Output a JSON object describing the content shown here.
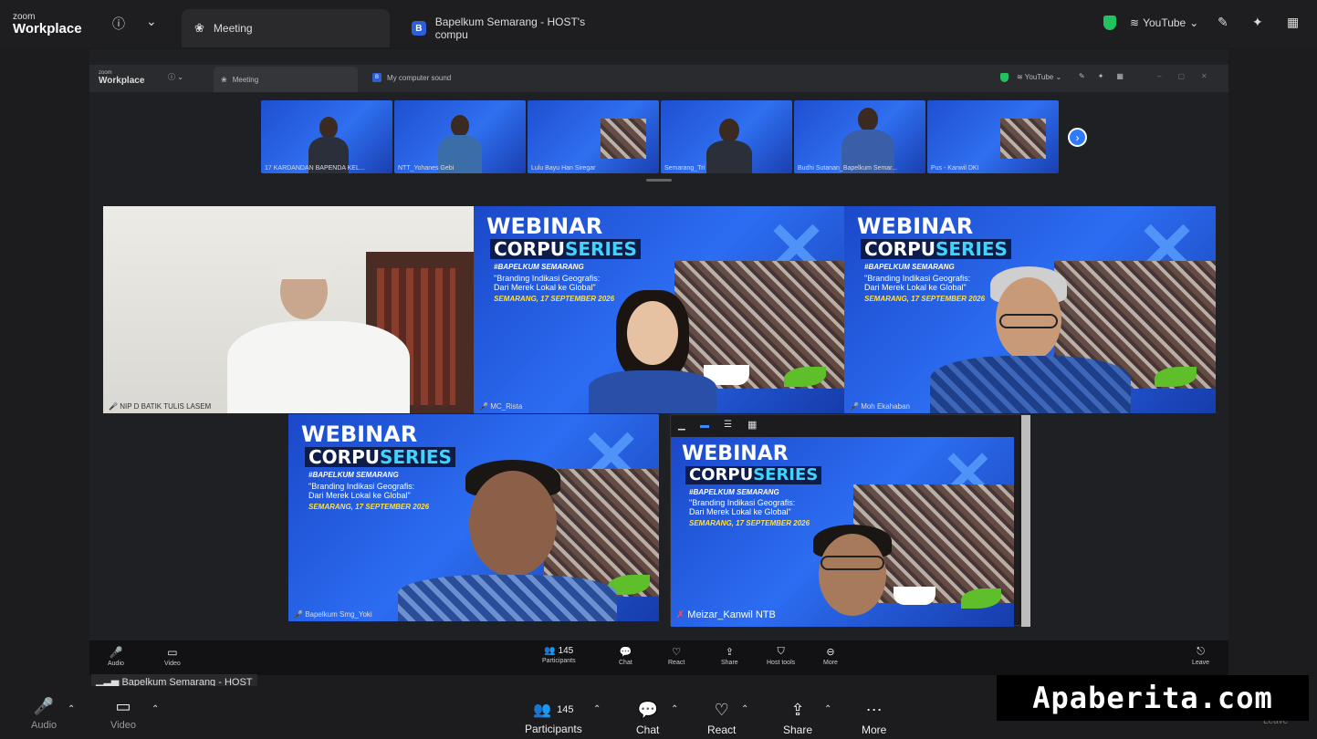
{
  "app": {
    "logo_small": "zoom",
    "logo_big": "Workplace"
  },
  "tabs": [
    {
      "label": "Meeting",
      "active": true
    },
    {
      "label": "Bapelkum Semarang - HOST's compu",
      "badge": "B",
      "active": false
    }
  ],
  "top_right": {
    "youtube_label": "YouTube"
  },
  "inner": {
    "logo_small": "zoom",
    "logo_big": "Workplace",
    "tab_meeting": "Meeting",
    "tab_screen": "My computer sound",
    "tab_badge": "B",
    "youtube_label": "YouTube",
    "strip": [
      "17 KARDANDAN BAPENDA KEL...",
      "NTT_Yohanes Gebi",
      "Lulu Bayu Han Siregar",
      "Semarang_Tri",
      "Budhi Sutanan_Bapelkum Semar...",
      "Pus - Kanwil DKI"
    ],
    "toolbar": [
      {
        "label": "Participants",
        "count": "145"
      },
      {
        "label": "Chat"
      },
      {
        "label": "React"
      },
      {
        "label": "Share"
      },
      {
        "label": "Host tools"
      },
      {
        "label": "More"
      }
    ],
    "audio_label": "Audio",
    "video_label": "Video",
    "leave_label": "Leave"
  },
  "webinar": {
    "title": "WEBINAR",
    "corpu": "CORPU",
    "series": "SERIES",
    "tag": "#BAPELKUM SEMARANG",
    "sub1": "\"Branding Indikasi Geografis:",
    "sub2": "Dari Merek Lokal ke Global\"",
    "date": "SEMARANG, 17 SEPTEMBER 2026"
  },
  "tiles": [
    {
      "name": "NIP D BATIK TULIS LASEM"
    },
    {
      "name": "MC_Rista"
    },
    {
      "name": "Moh Ekahaban"
    },
    {
      "name": "Bapelkum Smg_Yoki"
    },
    {
      "name": "Meizar_Kanwil NTB"
    }
  ],
  "host_label": "Bapelkum Semarang - HOST",
  "bottom_toolbar": {
    "audio": "Audio",
    "video": "Video",
    "participants": "Participants",
    "participants_count": "145",
    "chat": "Chat",
    "react": "React",
    "share": "Share",
    "more": "More",
    "leave": "Leave"
  },
  "watermark": "Apaberita.com"
}
